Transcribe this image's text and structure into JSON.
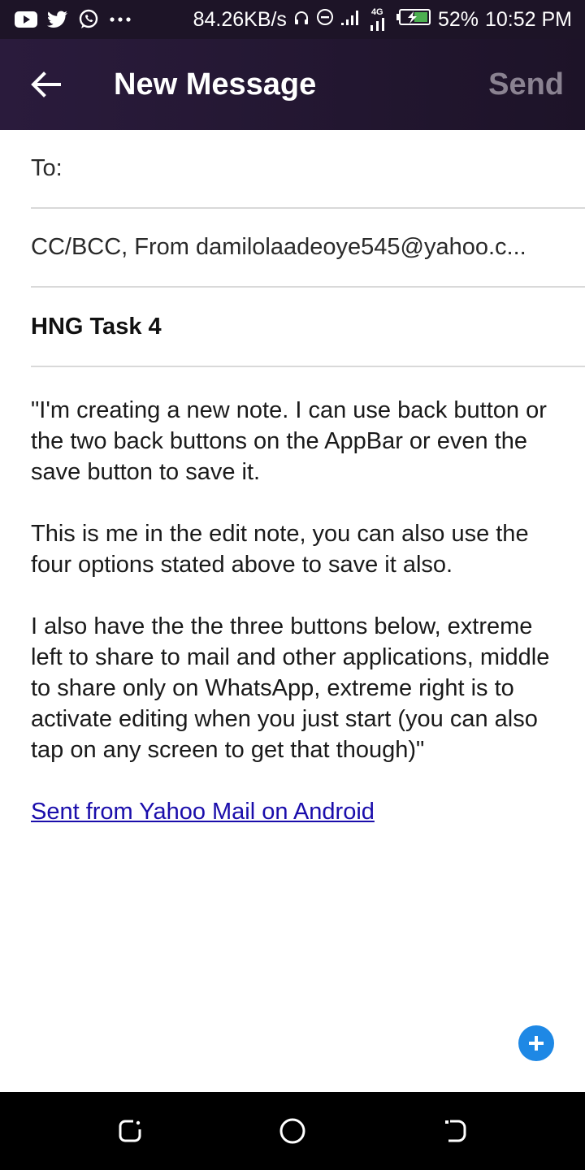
{
  "status_bar": {
    "speed": "84.26KB/s",
    "network_type": "4G",
    "battery": "52%",
    "time": "10:52 PM",
    "icons": [
      "youtube-icon",
      "twitter-icon",
      "whatsapp-icon",
      "more-dots-icon",
      "headphones-icon",
      "dnd-icon",
      "signal-icon",
      "4g-signal-icon",
      "battery-charging-icon"
    ]
  },
  "app_bar": {
    "title": "New Message",
    "send_label": "Send",
    "back_icon": "arrow-left-icon"
  },
  "compose": {
    "to_label": "To:",
    "cc_bcc_from": "CC/BCC, From damilolaadeoye545@yahoo.c...",
    "subject": "HNG Task 4",
    "body_paragraphs": [
      "\"I'm creating a new note. I can use back button or the two back buttons on the AppBar or even the save button to save it.",
      "This is me in the edit note, you can also use the four options stated above to save it also.",
      "I also have the the three buttons below, extreme left to share to mail and other applications, middle to share only on WhatsApp, extreme right is to activate editing when you just start (you can also tap on any screen to get that though)\""
    ],
    "signature": "Sent from Yahoo Mail on Android"
  },
  "colors": {
    "app_bar_bg": "#2a1b3c",
    "send_disabled": "#8a8291",
    "link": "#1a0dab",
    "fab": "#1e88e5"
  },
  "nav_bar": {
    "icons": [
      "recent-apps-icon",
      "home-icon",
      "back-icon"
    ]
  }
}
